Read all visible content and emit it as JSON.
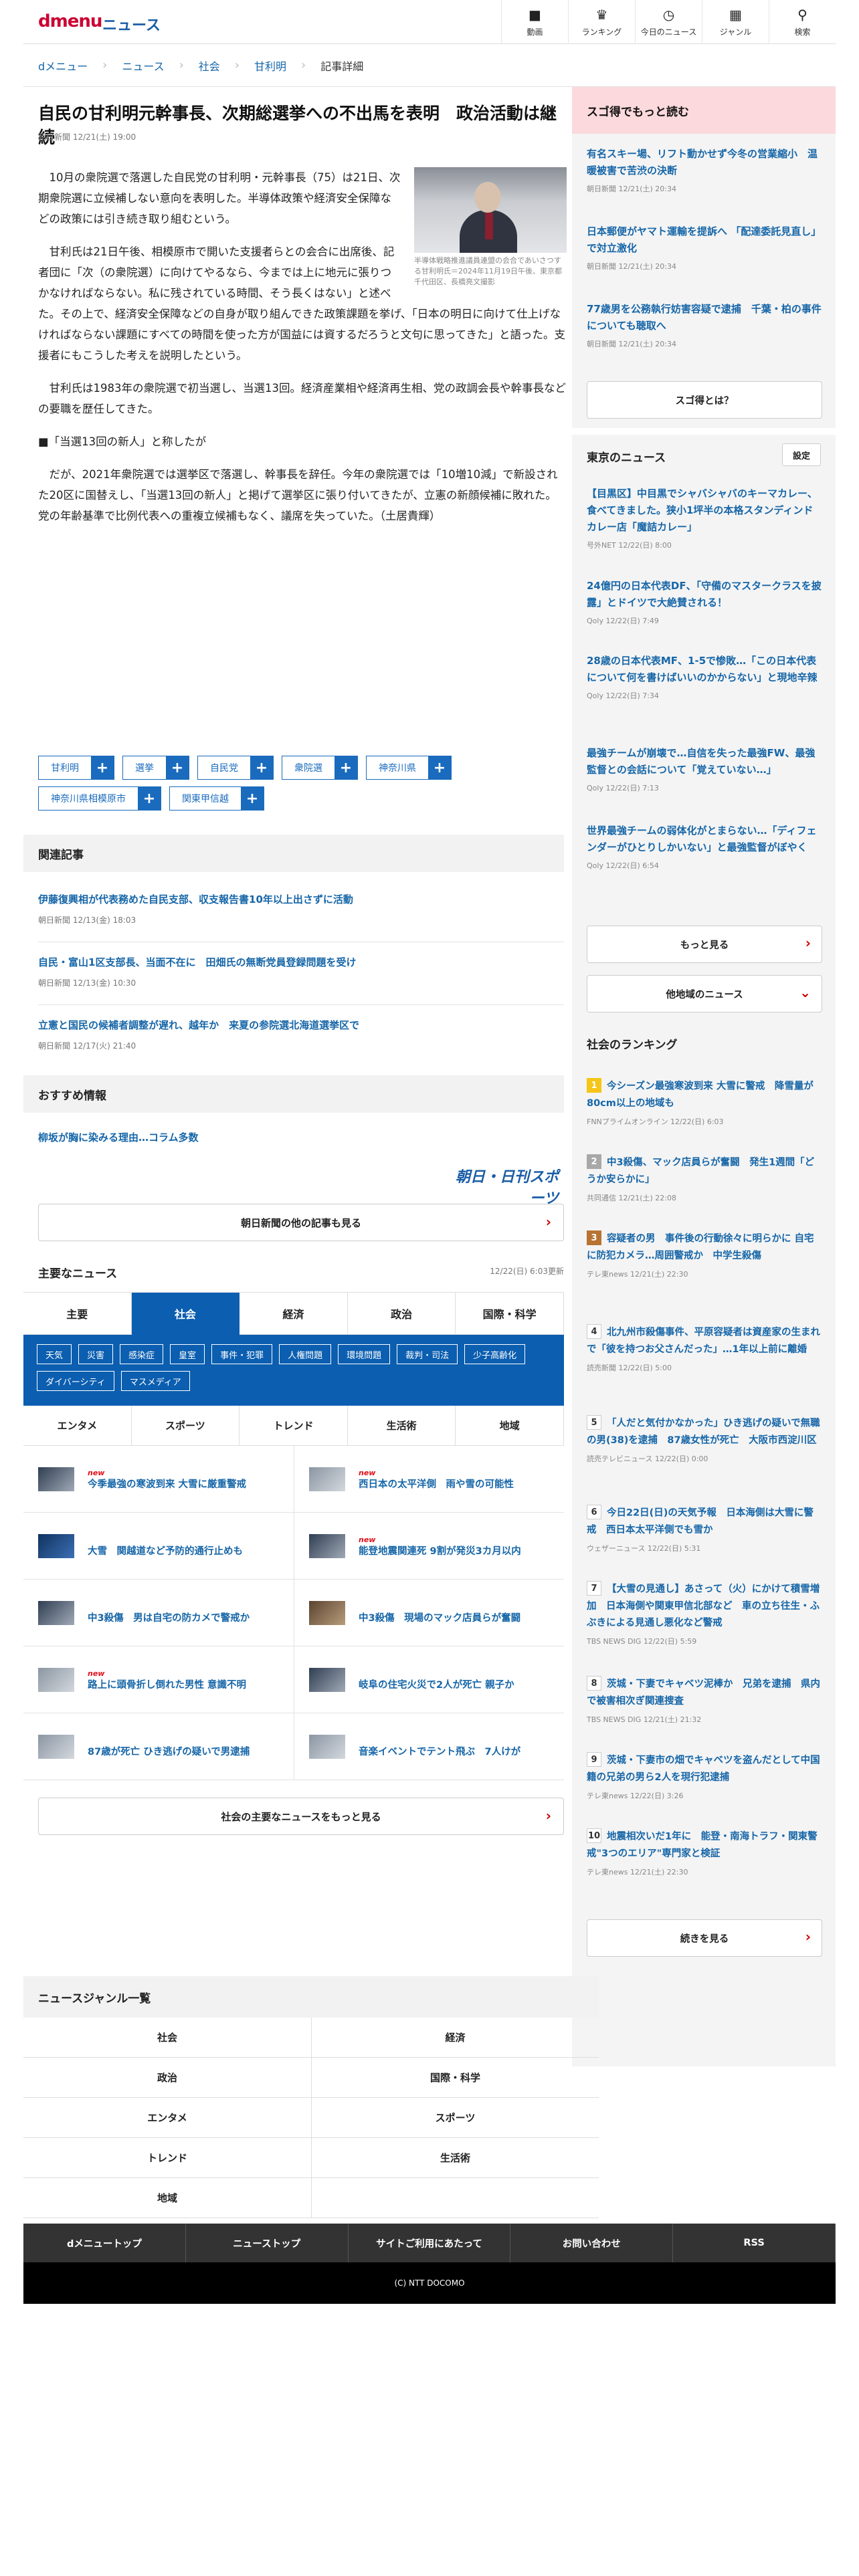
{
  "header": {
    "logo": "dmenu",
    "service": "ニュース",
    "nav": [
      {
        "icon": "video-icon",
        "glyph": "■",
        "label": "動画"
      },
      {
        "icon": "trophy-icon",
        "glyph": "♛",
        "label": "ランキング"
      },
      {
        "icon": "clock-icon",
        "glyph": "◷",
        "label": "今日のニュース"
      },
      {
        "icon": "grid-icon",
        "glyph": "▦",
        "label": "ジャンル"
      },
      {
        "icon": "search-icon",
        "glyph": "⚲",
        "label": "検索"
      }
    ]
  },
  "breadcrumb": [
    "dメニュー",
    "ニュース",
    "社会",
    "甘利明",
    "記事詳細"
  ],
  "article": {
    "title": "自民の甘利明元幹事長、次期総選挙への不出馬を表明　政治活動は継続",
    "date": "朝日新聞 12/21(土) 19:00",
    "photo_caption": "半導体戦略推進議員連盟の会合であいさつする甘利明氏＝2024年11月19日午後、東京都千代田区、長橋亮文撮影",
    "paragraphs": [
      "10月の衆院選で落選した自民党の甘利明・元幹事長（75）は21日、次期衆院選に立候補しない意向を表明した。半導体政策や経済安全保障などの政策には引き続き取り組むという。",
      "甘利氏は21日午後、相模原市で開いた支援者らとの会合に出席後、記者団に「次（の衆院選）に向けてやるなら、今までは上に地元に張りつかなければならない。私に残されている時間、そう長くはない」と述べた。その上で、経済安全保障などの自身が取り組んできた政策課題を挙げ、「日本の明日に向けて仕上げなければならない課題にすべての時間を使った方が国益には資するだろうと文句に思ってきた」と語った。支援者にもこうした考えを説明したという。",
      "甘利氏は1983年の衆院選で初当選し、当選13回。経済産業相や経済再生相、党の政調会長や幹事長などの要職を歴任してきた。"
    ],
    "subheading": "■「当選13回の新人」と称したが",
    "paragraphs2": [
      "だが、2021年衆院選では選挙区で落選し、幹事長を辞任。今年の衆院選では「10増10減」で新設された20区に国替えし、「当選13回の新人」と掲げて選挙区に張り付いてきたが、立憲の新顔候補に敗れた。党の年齢基準で比例代表への重複立候補もなく、議席を失っていた。（土居貴輝）"
    ],
    "tags": [
      "甘利明",
      "選挙",
      "自民党",
      "衆院選",
      "神奈川県",
      "神奈川県相模原市",
      "関東甲信越"
    ]
  },
  "related": {
    "heading": "関連記事",
    "items": [
      {
        "title": "伊藤復興相が代表務めた自民支部、収支報告書10年以上出さずに活動",
        "date": "朝日新聞 12/13(金) 18:03"
      },
      {
        "title": "自民・富山1区支部長、当面不在に　田畑氏の無断党員登録問題を受け",
        "date": "朝日新聞 12/13(金) 10:30"
      },
      {
        "title": "立憲と国民の候補者調整が遅れ、越年か　来夏の参院選北海道選挙区で",
        "date": "朝日新聞 12/17(火) 21:40"
      }
    ]
  },
  "recommend": {
    "heading": "おすすめ情報",
    "item": "柳坂が胸に染みる理由…コラム多数",
    "brand": "朝日・日刊スポーツ",
    "more_button": "朝日新聞の他の記事も見る"
  },
  "main_news": {
    "heading": "主要なニュース",
    "updated": "12/22(日) 6:03更新",
    "tabs": [
      "主要",
      "社会",
      "経済",
      "政治",
      "国際・科学"
    ],
    "active_tab": "社会",
    "sub_tags": [
      "天気",
      "災害",
      "感染症",
      "皇室",
      "事件・犯罪",
      "人権問題",
      "環境問題",
      "裁判・司法",
      "少子高齢化",
      "ダイバーシティ",
      "マスメディア"
    ],
    "tabs2": [
      "エンタメ",
      "スポーツ",
      "トレンド",
      "生活術",
      "地域"
    ],
    "items": [
      {
        "title": "今季最強の寒波到来 大雪に厳重警戒",
        "new": "new"
      },
      {
        "title": "西日本の太平洋側　雨や雪の可能性",
        "new": "new"
      },
      {
        "title": "大雪　関越道など予防的通行止めも",
        "new": ""
      },
      {
        "title": "能登地震関連死 9割が発災3カ月以内",
        "new": "new"
      },
      {
        "title": "中3殺傷　男は自宅の防カメで警戒か",
        "new": ""
      },
      {
        "title": "中3殺傷　現場のマック店員らが奮闘",
        "new": ""
      },
      {
        "title": "路上に頭骨折し倒れた男性 意識不明",
        "new": "new"
      },
      {
        "title": "岐阜の住宅火災で2人が死亡 親子か",
        "new": ""
      },
      {
        "title": "87歳が死亡 ひき逃げの疑いで男逮捕",
        "new": ""
      },
      {
        "title": "音楽イベントでテント飛ぶ　7人けが",
        "new": ""
      }
    ],
    "more_button": "社会の主要なニュースをもっと見る"
  },
  "sidebar": {
    "sugo": {
      "heading": "スゴ得でもっと読む",
      "items": [
        {
          "title": "有名スキー場、リフト動かせず今冬の営業縮小　温暖被害で苦渋の決断",
          "date": "朝日新聞 12/21(土) 20:34"
        },
        {
          "title": "日本郵便がヤマト運輸を提訴へ 「配達委託見直し」で対立激化",
          "date": "朝日新聞 12/21(土) 20:34"
        },
        {
          "title": "77歳男を公務執行妨害容疑で逮捕　千葉・柏の事件についても聴取へ",
          "date": "朝日新聞 12/21(土) 20:34"
        }
      ],
      "button": "スゴ得とは？"
    },
    "tokyo": {
      "heading": "東京のニュース",
      "settings": "設定",
      "items": [
        {
          "title": "【目黒区】中目黒でシャバシャバのキーマカレー、食べてきました。狭小1坪半の本格スタンディンドカレー店「魔詰カレー」",
          "date": "号外NET 12/22(日) 8:00"
        },
        {
          "title": "24億円の日本代表DF、「守備のマスタークラスを披露」とドイツで大絶賛される！",
          "date": "Qoly 12/22(日) 7:49"
        },
        {
          "title": "28歳の日本代表MF、1-5で惨敗…「この日本代表について何を書けばいいのかからない」と現地辛辣",
          "date": "Qoly 12/22(日) 7:34"
        },
        {
          "title": "最強チームが崩壊で…自信を失った最強FW、最強監督との会話について「覚えていない…」",
          "date": "Qoly 12/22(日) 7:13"
        },
        {
          "title": "世界最強チームの弱体化がとまらない…「ディフェンダーがひとりしかいない」と最強監督がぼやく",
          "date": "Qoly 12/22(日) 6:54"
        }
      ],
      "more": "もっと見る",
      "other": "他地域のニュース"
    },
    "ranking": {
      "heading": "社会のランキング",
      "items": [
        {
          "n": "1",
          "title": "今シーズン最強寒波到来 大雪に警戒　降雪量が80cm以上の地域も",
          "date": "FNNプライムオンライン 12/22(日) 6:03"
        },
        {
          "n": "2",
          "title": "中3殺傷、マック店員らが奮闘　発生1週間「どうか安らかに」",
          "date": "共同通信 12/21(土) 22:08"
        },
        {
          "n": "3",
          "title": "容疑者の男　事件後の行動徐々に明らかに 自宅に防犯カメラ…周囲警戒か　中学生殺傷",
          "date": "テレ東news 12/21(土) 22:30"
        },
        {
          "n": "4",
          "title": "北九州市殺傷事件、平原容疑者は資産家の生まれで「彼を持つお父さんだった」…1年以上前に離婚",
          "date": "読売新聞 12/22(日) 5:00"
        },
        {
          "n": "5",
          "title": "「人だと気付かなかった」ひき逃げの疑いで無職の男(38)を逮捕　87歳女性が死亡　大阪市西淀川区",
          "date": "読売テレビニュース 12/22(日) 0:00"
        },
        {
          "n": "6",
          "title": "今日22日(日)の天気予報　日本海側は大雪に警戒　西日本太平洋側でも雪か",
          "date": "ウェザーニュース 12/22(日) 5:31"
        },
        {
          "n": "7",
          "title": "【大雪の見通し】あさって（火）にかけて積雪増加　日本海側や関東甲信北部など　車の立ち往生・ふぶきによる見通し悪化など警戒",
          "date": "TBS NEWS DIG 12/22(日) 5:59"
        },
        {
          "n": "8",
          "title": "茨城・下妻でキャベツ泥棒か　兄弟を逮捕　県内で被害相次ぎ関連捜査",
          "date": "TBS NEWS DIG 12/21(土) 21:32"
        },
        {
          "n": "9",
          "title": "茨城・下妻市の畑でキャベツを盗んだとして中国籍の兄弟の男ら2人を現行犯逮捕",
          "date": "テレ東news 12/22(日) 3:26"
        },
        {
          "n": "10",
          "title": "地震相次いだ1年に　能登・南海トラフ・関東警戒\"3つのエリア\"専門家と検証",
          "date": "テレ東news 12/21(土) 22:30"
        }
      ],
      "more": "続きを見る"
    }
  },
  "genre": {
    "heading": "ニュースジャンル一覧",
    "items": [
      "社会",
      "経済",
      "政治",
      "国際・科学",
      "エンタメ",
      "スポーツ",
      "トレンド",
      "生活術",
      "地域"
    ]
  },
  "footer": {
    "links": [
      "dメニュートップ",
      "ニューストップ",
      "サイトご利用にあたって",
      "お問い合わせ",
      "RSS"
    ],
    "copyright": "(C) NTT DOCOMO"
  }
}
